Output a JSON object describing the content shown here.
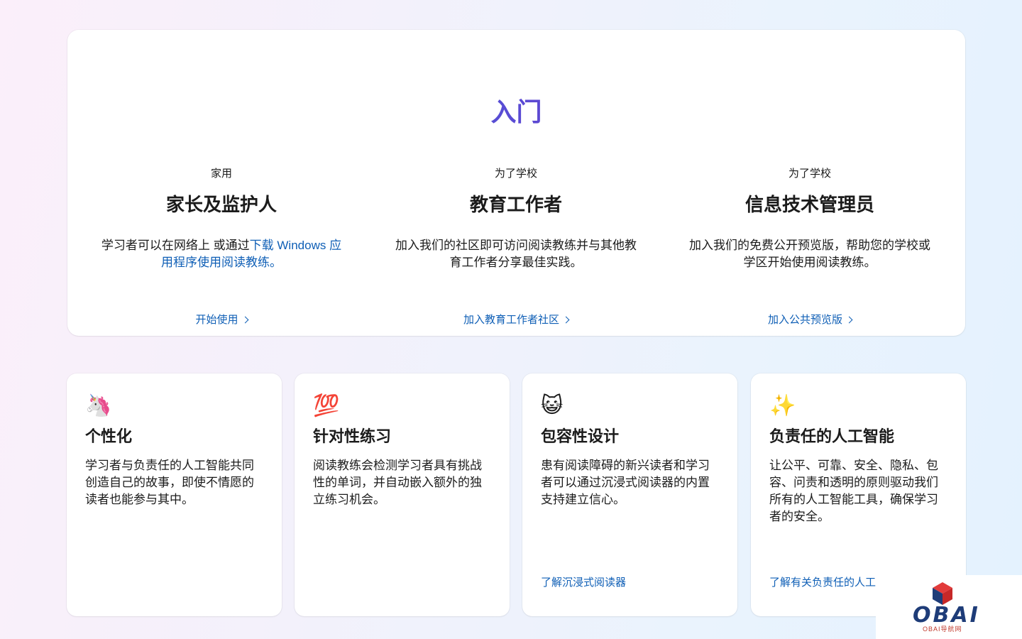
{
  "section": {
    "title": "入门"
  },
  "columns": [
    {
      "kicker": "家用",
      "heading": "家长及监护人",
      "desc_pre": "学习者可以在网络上 或通过",
      "desc_link": "下载 Windows 应用程序使用阅读教练。",
      "cta": "开始使用"
    },
    {
      "kicker": "为了学校",
      "heading": "教育工作者",
      "desc_pre": "加入我们的社区即可访问阅读教练并与其他教育工作者分享最佳实践。",
      "desc_link": "",
      "cta": "加入教育工作者社区"
    },
    {
      "kicker": "为了学校",
      "heading": "信息技术管理员",
      "desc_pre": "加入我们的免费公开预览版，帮助您的学校或学区开始使用阅读教练。",
      "desc_link": "",
      "cta": "加入公共预览版"
    }
  ],
  "features": [
    {
      "emoji": "🦄",
      "icon": "unicorn-icon",
      "title": "个性化",
      "desc": "学习者与负责任的人工智能共同创造自己的故事，即使不情愿的读者也能参与其中。",
      "link": ""
    },
    {
      "emoji": "💯",
      "icon": "hundred-points-icon",
      "title": "针对性练习",
      "desc": "阅读教练会检测学习者具有挑战性的单词，并自动嵌入额外的独立练习机会。",
      "link": ""
    },
    {
      "emoji": "😺",
      "icon": "cat-face-icon",
      "title": "包容性设计",
      "desc": "患有阅读障碍的新兴读者和学习者可以通过沉浸式阅读器的内置支持建立信心。",
      "link": "了解沉浸式阅读器"
    },
    {
      "emoji": "✨",
      "icon": "sparkles-icon",
      "title": "负责任的人工智能",
      "desc": "让公平、可靠、安全、隐私、包容、问责和透明的原则驱动我们所有的人工智能工具，确保学习者的安全。",
      "link": "了解有关负责任的人工智能的信息"
    }
  ],
  "watermark": {
    "brand": "OBAI",
    "sub": "OBAI导航网"
  },
  "colors": {
    "link": "#0f5fb6",
    "title_gradient_start": "#2b74d9",
    "title_gradient_end": "#8a1fa8"
  }
}
